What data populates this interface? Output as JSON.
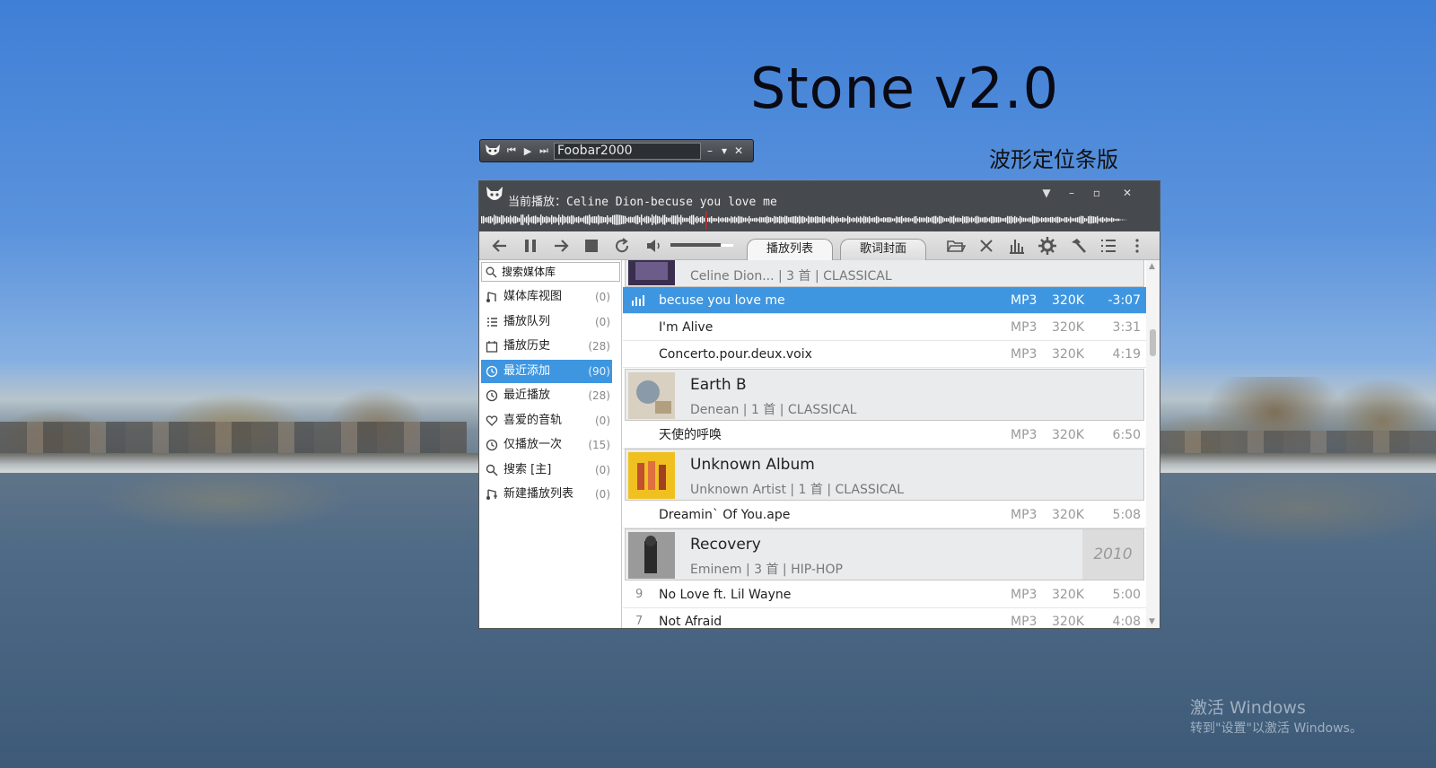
{
  "desktop": {
    "big_title": "Stone v2.0",
    "sub_title": "波形定位条版",
    "watermark_line1": "激活 Windows",
    "watermark_line2": "转到\"设置\"以激活 Windows。"
  },
  "mini_player": {
    "title_field": "Foobar2000",
    "icons": [
      "foobar-logo-icon",
      "prev-icon",
      "play-icon",
      "next-icon",
      "minimize-icon",
      "dropdown-icon",
      "close-icon"
    ]
  },
  "window": {
    "now_playing_label": "当前播放：",
    "now_playing_track": "Celine Dion-becuse you love me",
    "volume_percent": 80,
    "tabs": [
      {
        "label": "播放列表",
        "active": true
      },
      {
        "label": "歌词封面",
        "active": false
      }
    ]
  },
  "sidebar": {
    "search_placeholder": "搜索媒体库",
    "items": [
      {
        "label": "媒体库视图",
        "count": "(0)",
        "icon": "library-note-icon",
        "selected": false
      },
      {
        "label": "播放队列",
        "count": "(0)",
        "icon": "queue-list-icon",
        "selected": false
      },
      {
        "label": "播放历史",
        "count": "(28)",
        "icon": "calendar-icon",
        "selected": false
      },
      {
        "label": "最近添加",
        "count": "(90)",
        "icon": "clock-icon",
        "selected": true
      },
      {
        "label": "最近播放",
        "count": "(28)",
        "icon": "clock-icon",
        "selected": false
      },
      {
        "label": "喜爱的音轨",
        "count": "(0)",
        "icon": "heart-icon",
        "selected": false
      },
      {
        "label": "仅播放一次",
        "count": "(15)",
        "icon": "clock-icon",
        "selected": false
      },
      {
        "label": "搜索 [主]",
        "count": "(0)",
        "icon": "search-icon",
        "selected": false
      },
      {
        "label": "新建播放列表",
        "count": "(0)",
        "icon": "playlist-note-icon",
        "selected": false
      }
    ]
  },
  "playlist": {
    "partial_group": {
      "meta": "Celine Dion... | 3 首 | CLASSICAL"
    },
    "rows": [
      {
        "title": "becuse you love me",
        "format": "MP3",
        "bitrate": "320K",
        "duration": "-3:07",
        "playing": true
      },
      {
        "title": "I'm Alive",
        "format": "MP3",
        "bitrate": "320K",
        "duration": "3:31"
      },
      {
        "title": "Concerto.pour.deux.voix",
        "format": "MP3",
        "bitrate": "320K",
        "duration": "4:19"
      }
    ],
    "group_earth": {
      "name": "Earth B",
      "meta": "Denean | 1 首 | CLASSICAL"
    },
    "row_tianshi": {
      "title": "天使的呼唤",
      "format": "MP3",
      "bitrate": "320K",
      "duration": "6:50"
    },
    "group_unknown": {
      "name": "Unknown Album",
      "meta": "Unknown Artist | 1 首 | CLASSICAL"
    },
    "row_dreamin": {
      "title": "Dreamin` Of You.ape",
      "format": "MP3",
      "bitrate": "320K",
      "duration": "5:08"
    },
    "group_recovery": {
      "name": "Recovery",
      "meta": "Eminem | 3 首 | HIP-HOP",
      "year": "2010"
    },
    "row_nolove": {
      "num": "9",
      "title": "No Love ft. Lil Wayne",
      "format": "MP3",
      "bitrate": "320K",
      "duration": "5:00"
    },
    "row_notafraid": {
      "num": "7",
      "title": "Not Afraid",
      "format": "MP3",
      "bitrate": "320K",
      "duration": "4:08"
    }
  },
  "colors": {
    "accent": "#3f96e0",
    "titlebar": "#46494d"
  }
}
